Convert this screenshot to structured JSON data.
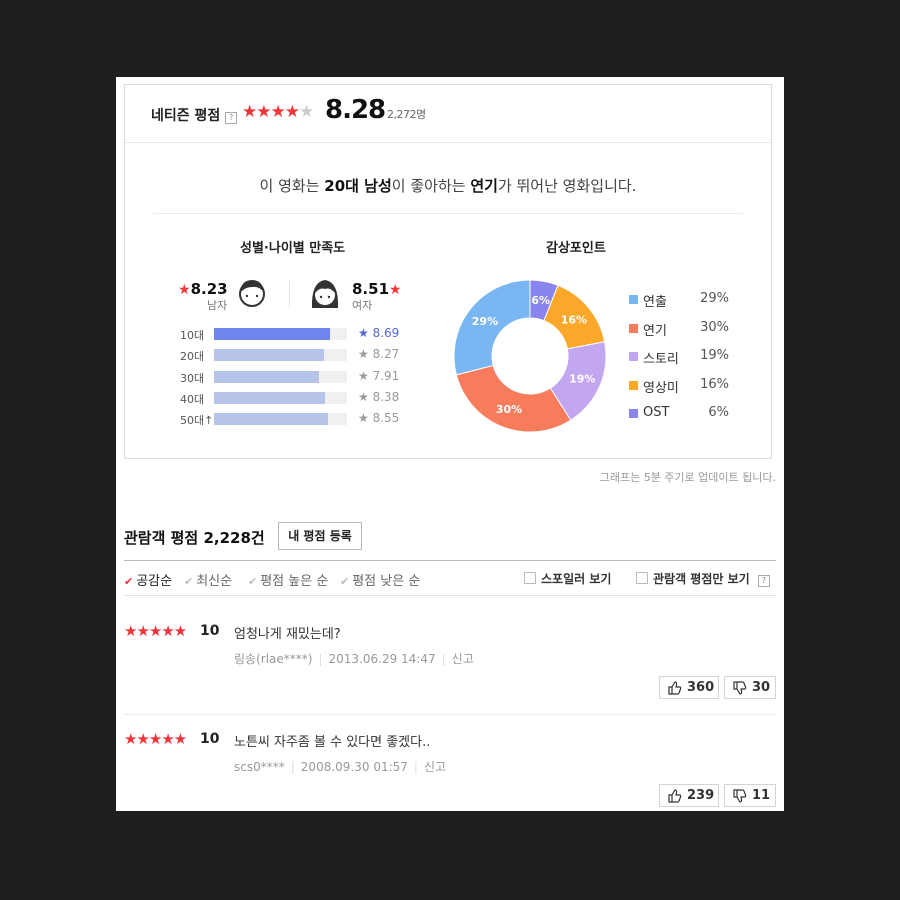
{
  "netizen": {
    "title": "네티즌 평점",
    "help": "?",
    "score": "8.28",
    "count": "2,272명",
    "stars_on": 4
  },
  "summary": {
    "pre": "이 영화는 ",
    "demo": "20대 남성",
    "mid": "이 좋아하는 ",
    "point": "연기",
    "post": "가 뛰어난 영화입니다."
  },
  "demographics": {
    "title": "성별·나이별 만족도",
    "male": {
      "score": "8.23",
      "label": "남자"
    },
    "female": {
      "score": "8.51",
      "label": "여자"
    },
    "ages": [
      {
        "label": "10대",
        "score": "8.69",
        "value": 8.69,
        "highlight": true
      },
      {
        "label": "20대",
        "score": "8.27",
        "value": 8.27,
        "highlight": false
      },
      {
        "label": "30대",
        "score": "7.91",
        "value": 7.91,
        "highlight": false
      },
      {
        "label": "40대",
        "score": "8.38",
        "value": 8.38,
        "highlight": false
      },
      {
        "label": "50대↑",
        "score": "8.55",
        "value": 8.55,
        "highlight": false
      }
    ]
  },
  "points": {
    "title": "감상포인트",
    "items": [
      {
        "name": "연출",
        "pct": "29%",
        "value": 29,
        "color": "#7ab6f2"
      },
      {
        "name": "연기",
        "pct": "30%",
        "value": 30,
        "color": "#f77c5b"
      },
      {
        "name": "스토리",
        "pct": "19%",
        "value": 19,
        "color": "#c3a6f0"
      },
      {
        "name": "영상미",
        "pct": "16%",
        "value": 16,
        "color": "#f9a82a"
      },
      {
        "name": "OST",
        "pct": "6%",
        "value": 6,
        "color": "#8a84ef"
      }
    ]
  },
  "chart_data": {
    "type": "pie",
    "categories": [
      "연출",
      "연기",
      "스토리",
      "영상미",
      "OST"
    ],
    "values": [
      29,
      30,
      19,
      16,
      6
    ],
    "title": "감상포인트"
  },
  "update_note": "그래프는 5분 주기로 업데이트 됩니다.",
  "audience": {
    "title": "관람객 평점 2,228건",
    "register_button": "내 평점 등록",
    "sorts": [
      {
        "label": "공감순",
        "active": true
      },
      {
        "label": "최신순",
        "active": false
      },
      {
        "label": "평점 높은 순",
        "active": false
      },
      {
        "label": "평점 낮은 순",
        "active": false
      }
    ],
    "spoiler_label": "스포일러 보기",
    "audience_only_label": "관람객 평점만 보기",
    "help": "?"
  },
  "reviews": [
    {
      "stars": "★★★★★",
      "score": "10",
      "text": "엄청나게 재밌는데?",
      "user": "링송(rlae****)",
      "date": "2013.06.29 14:47",
      "report": "신고",
      "likes": "360",
      "dislikes": "30"
    },
    {
      "stars": "★★★★★",
      "score": "10",
      "text": "노튼씨 자주좀 볼 수 있다면 좋겠다..",
      "user": "scs0****",
      "date": "2008.09.30 01:57",
      "report": "신고",
      "likes": "239",
      "dislikes": "11"
    }
  ]
}
